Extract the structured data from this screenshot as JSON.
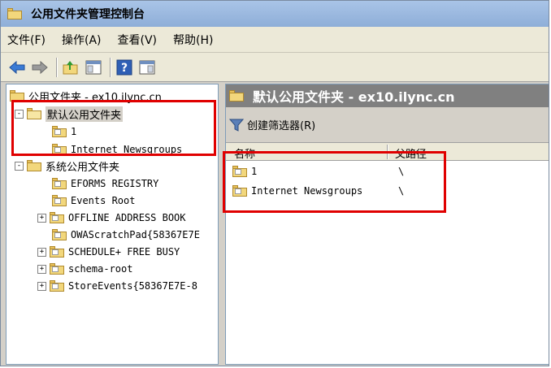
{
  "window": {
    "title": "公用文件夹管理控制台"
  },
  "menu": [
    "文件(F)",
    "操作(A)",
    "查看(V)",
    "帮助(H)"
  ],
  "toolbar": [
    "back-icon",
    "forward-icon",
    "up-folder-icon",
    "show-hide-tree-icon",
    "help-icon",
    "console-tree-icon"
  ],
  "tree": {
    "root": "公用文件夹 - ex10.ilync.cn",
    "default_folder": "默认公用文件夹",
    "default_children": [
      "1",
      "Internet Newsgroups"
    ],
    "system_folder": "系统公用文件夹",
    "system_children": [
      {
        "label": "EFORMS REGISTRY",
        "expander": ""
      },
      {
        "label": "Events Root",
        "expander": ""
      },
      {
        "label": "OFFLINE ADDRESS BOOK",
        "expander": "+"
      },
      {
        "label": "OWAScratchPad{58367E7E",
        "expander": ""
      },
      {
        "label": "SCHEDULE+ FREE BUSY",
        "expander": "+"
      },
      {
        "label": "schema-root",
        "expander": "+"
      },
      {
        "label": "StoreEvents{58367E7E-8",
        "expander": "+"
      }
    ],
    "default_expander": "-",
    "system_expander": "-"
  },
  "right": {
    "header": "默认公用文件夹 - ex10.ilync.cn",
    "create_filter": "创建筛选器(R)",
    "columns": [
      "名称",
      "父路径"
    ],
    "rows": [
      {
        "name": "1",
        "parent": "\\"
      },
      {
        "name": "Internet Newsgroups",
        "parent": "\\"
      }
    ]
  }
}
